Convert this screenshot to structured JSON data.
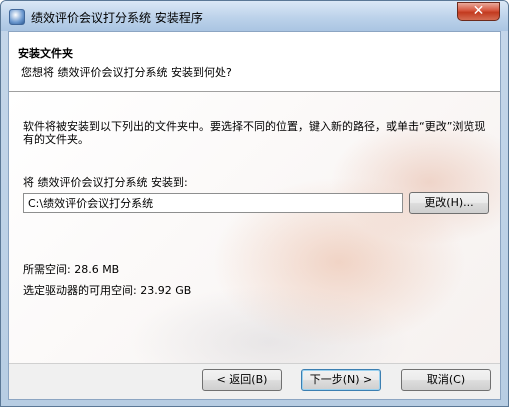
{
  "window": {
    "title": "绩效评价会议打分系统 安装程序",
    "close_glyph": "✕"
  },
  "header": {
    "title": "安装文件夹",
    "subtitle": "您想将 绩效评价会议打分系统 安装到何处?"
  },
  "body": {
    "description": "软件将被安装到以下列出的文件夹中。要选择不同的位置，键入新的路径，或单击“更改”浏览现有的文件夹。",
    "install_label": "将 绩效评价会议打分系统 安装到:",
    "install_path": "C:\\绩效评价会议打分系统",
    "browse_label": "更改(H)...",
    "space_required": "所需空间: 28.6 MB",
    "space_available": "选定驱动器的可用空间: 23.92 GB"
  },
  "footer": {
    "back_label": "< 返回(B)",
    "next_label": "下一步(N) >",
    "cancel_label": "取消(C)"
  }
}
